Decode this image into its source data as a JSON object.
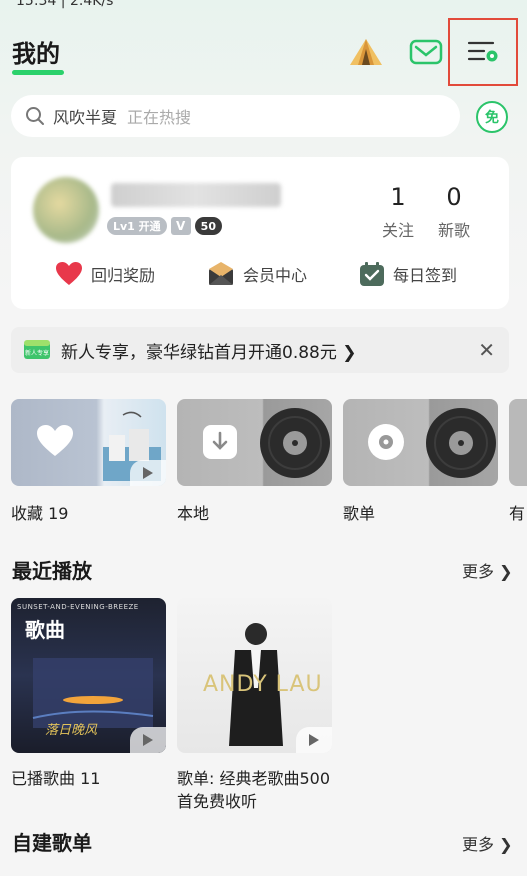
{
  "status": {
    "time_text": "15:34 | 2.4K/s"
  },
  "header": {
    "title": "我的"
  },
  "search": {
    "hot_word": "风吹半夏",
    "hint": "正在热搜",
    "free_badge": "免"
  },
  "profile": {
    "level_badge": "Lv1 开通",
    "vip_badge": "V",
    "listen_badge": "50",
    "follow_count": "1",
    "follow_label": "关注",
    "new_count": "0",
    "new_label": "新歌",
    "shortcuts": [
      {
        "label": "回归奖励",
        "icon": "heart-icon"
      },
      {
        "label": "会员中心",
        "icon": "vip-envelope-icon"
      },
      {
        "label": "每日签到",
        "icon": "calendar-check-icon"
      }
    ]
  },
  "promo": {
    "badge": "新人专享",
    "text": "新人专享，豪华绿钻首月开通0.88元 ❯",
    "close": "✕"
  },
  "tiles": [
    {
      "label": "收藏 19",
      "icon": "heart-icon"
    },
    {
      "label": "本地",
      "icon": "download-icon"
    },
    {
      "label": "歌单",
      "icon": "disc-icon"
    },
    {
      "label": "有"
    }
  ],
  "recent": {
    "title": "最近播放",
    "more": "更多 ❯",
    "items": [
      {
        "label": "已播歌曲 11",
        "cover_title": "歌曲",
        "cover_caption": "SUNSET-AND-EVENING-BREEZE"
      },
      {
        "label": "歌单: 经典老歌曲500首免费收听",
        "cover_caption": "ANDY LAU"
      }
    ]
  },
  "playlists": {
    "title": "自建歌单",
    "more": "更多 ❯"
  },
  "colors": {
    "accent": "#2bd16b",
    "highlight_box": "#e24a3a"
  }
}
